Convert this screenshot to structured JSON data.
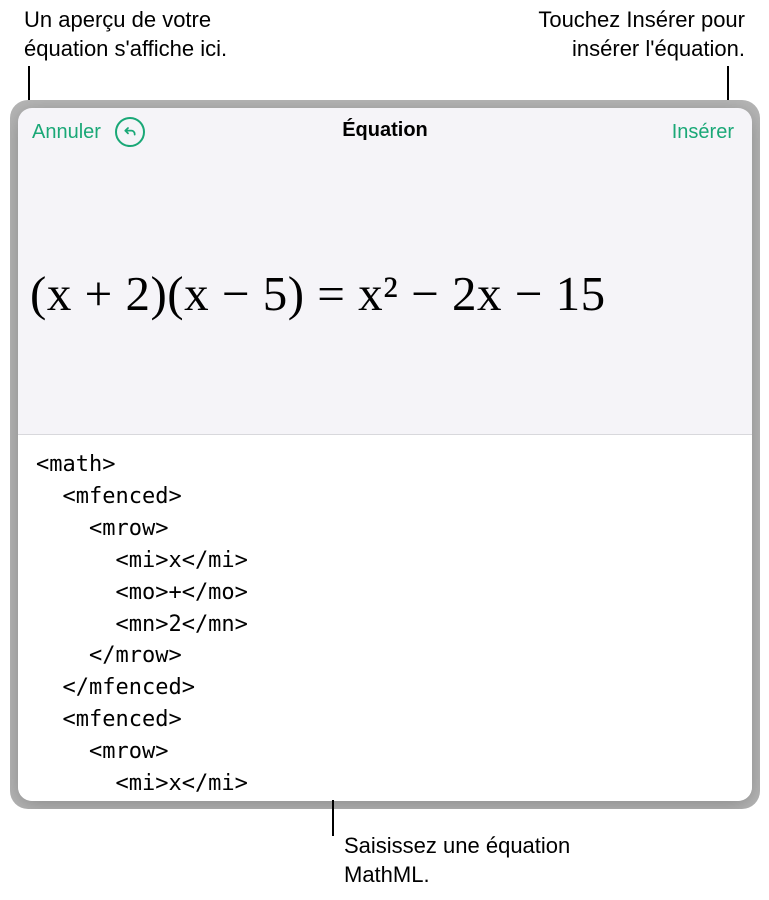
{
  "callouts": {
    "top_left_line1": "Un aperçu de votre",
    "top_left_line2": "équation s'affiche ici.",
    "top_right_line1": "Touchez Insérer pour",
    "top_right_line2": "insérer l'équation.",
    "bottom_line1": "Saisissez une équation",
    "bottom_line2": "MathML."
  },
  "dialog": {
    "cancel_label": "Annuler",
    "title": "Équation",
    "insert_label": "Insérer"
  },
  "equation_preview": "(x + 2)(x − 5) = x² − 2x − 15",
  "mathml_code": "<math>\n  <mfenced>\n    <mrow>\n      <mi>x</mi>\n      <mo>+</mo>\n      <mn>2</mn>\n    </mrow>\n  </mfenced>\n  <mfenced>\n    <mrow>\n      <mi>x</mi>\n      <mo>-</mo>",
  "colors": {
    "accent": "#1aa877",
    "dialog_bg": "#f5f4f8",
    "frame_bg": "#b7b7b7"
  }
}
